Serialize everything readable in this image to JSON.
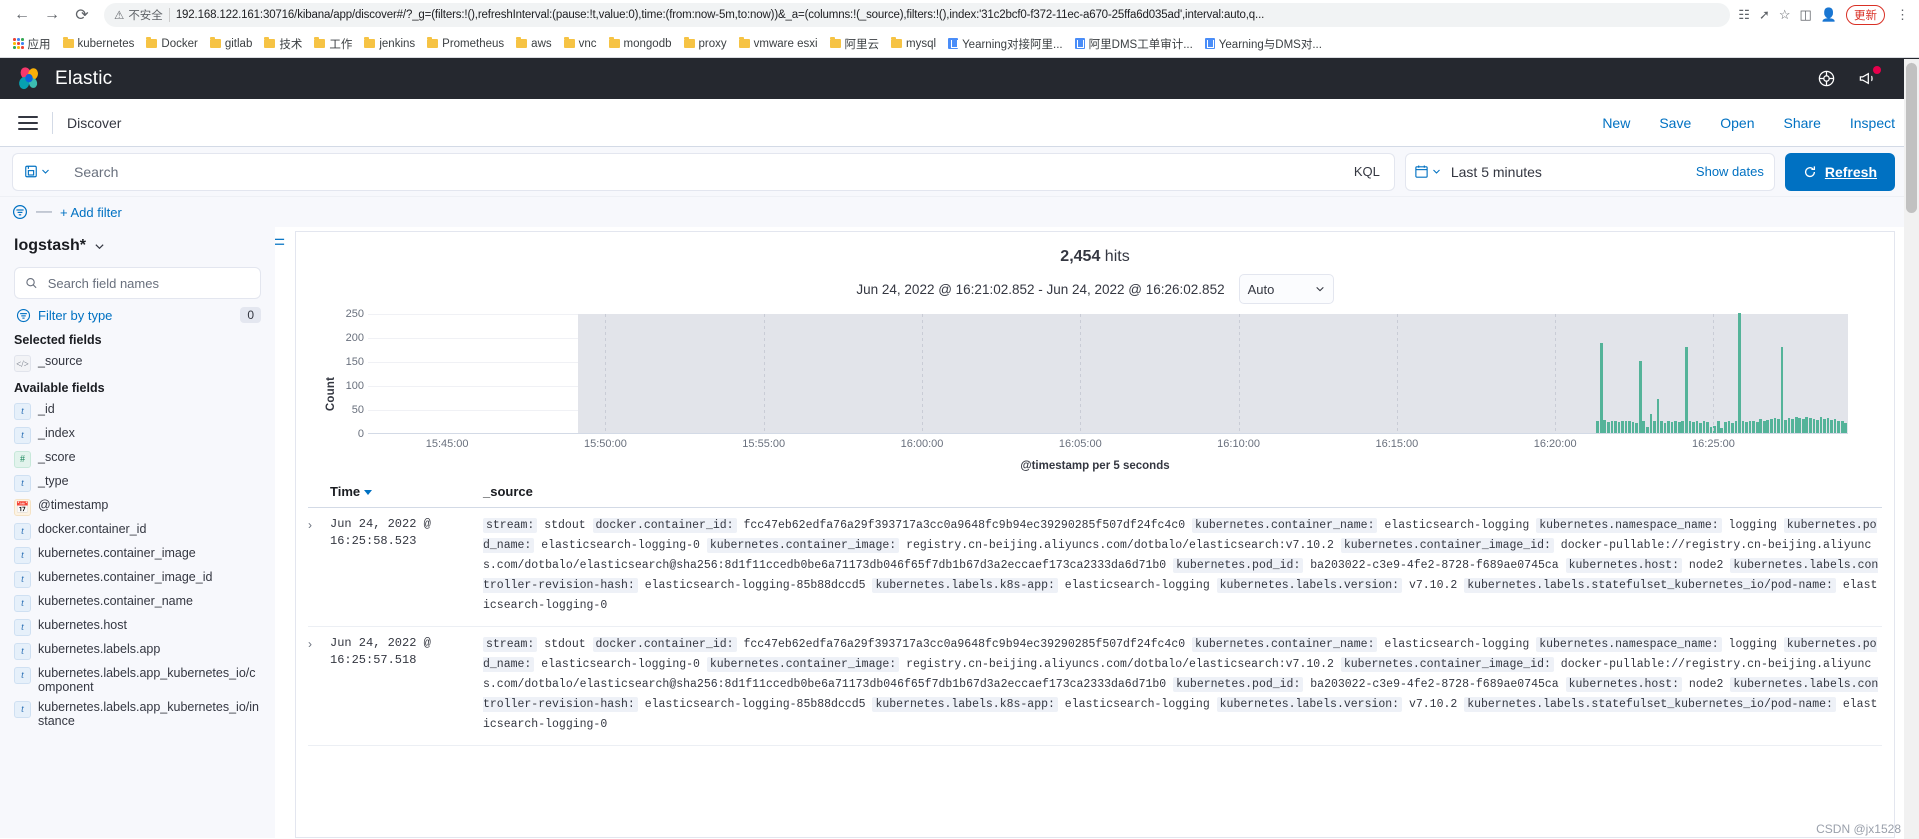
{
  "browser": {
    "back_icon": "back-arrow",
    "forward_icon": "forward-arrow",
    "reload_icon": "reload",
    "security_label": "不安全",
    "url": "192.168.122.161:30716/kibana/app/discover#/?_g=(filters:!(),refreshInterval:(pause:!t,value:0),time:(from:now-5m,to:now))&_a=(columns:!(_source),filters:!(),index:'31c2bcf0-f372-11ec-a670-25ffa6d035ad',interval:auto,q...",
    "update_label": "更新",
    "apps_label": "应用",
    "bookmarks": [
      {
        "label": "kubernetes",
        "type": "folder"
      },
      {
        "label": "Docker",
        "type": "folder"
      },
      {
        "label": "gitlab",
        "type": "folder"
      },
      {
        "label": "技术",
        "type": "folder"
      },
      {
        "label": "工作",
        "type": "folder"
      },
      {
        "label": "jenkins",
        "type": "folder"
      },
      {
        "label": "Prometheus",
        "type": "folder"
      },
      {
        "label": "aws",
        "type": "folder"
      },
      {
        "label": "vnc",
        "type": "folder"
      },
      {
        "label": "mongodb",
        "type": "folder"
      },
      {
        "label": "proxy",
        "type": "folder"
      },
      {
        "label": "vmware esxi",
        "type": "folder"
      },
      {
        "label": "阿里云",
        "type": "folder"
      },
      {
        "label": "mysql",
        "type": "folder"
      },
      {
        "label": "Yearning对接阿里...",
        "type": "bookmark"
      },
      {
        "label": "阿里DMS工单审计...",
        "type": "bookmark"
      },
      {
        "label": "Yearning与DMS对...",
        "type": "bookmark"
      }
    ]
  },
  "header": {
    "brand": "Elastic",
    "help_icon": "help-circle-icon",
    "news_icon": "megaphone-icon"
  },
  "breadcrumb": {
    "title": "Discover",
    "links": [
      "New",
      "Save",
      "Open",
      "Share",
      "Inspect"
    ]
  },
  "query": {
    "save_query_icon": "save-query-icon",
    "placeholder": "Search",
    "language": "KQL",
    "date_range": "Last 5 minutes",
    "show_dates": "Show dates",
    "refresh": "Refresh",
    "calendar_icon": "calendar-icon"
  },
  "filters": {
    "add_filter": "+ Add filter",
    "filter_icon": "filter-icon"
  },
  "sidebar": {
    "index_pattern": "logstash*",
    "search_placeholder": "Search field names",
    "filter_by_type": "Filter by type",
    "filter_count": "0",
    "selected_title": "Selected fields",
    "available_title": "Available fields",
    "selected_fields": [
      {
        "name": "_source",
        "type": "src"
      }
    ],
    "available_fields": [
      {
        "name": "_id",
        "type": "t"
      },
      {
        "name": "_index",
        "type": "t"
      },
      {
        "name": "_score",
        "type": "num"
      },
      {
        "name": "_type",
        "type": "t"
      },
      {
        "name": "@timestamp",
        "type": "date"
      },
      {
        "name": "docker.container_id",
        "type": "t"
      },
      {
        "name": "kubernetes.container_image",
        "type": "t"
      },
      {
        "name": "kubernetes.container_image_id",
        "type": "t"
      },
      {
        "name": "kubernetes.container_name",
        "type": "t"
      },
      {
        "name": "kubernetes.host",
        "type": "t"
      },
      {
        "name": "kubernetes.labels.app",
        "type": "t"
      },
      {
        "name": "kubernetes.labels.app_kubernetes_io/component",
        "type": "t"
      },
      {
        "name": "kubernetes.labels.app_kubernetes_io/instance",
        "type": "t"
      }
    ]
  },
  "main": {
    "hits_count": "2,454",
    "hits_label": "hits",
    "range_text": "Jun 24, 2022 @ 16:21:02.852 - Jun 24, 2022 @ 16:26:02.852",
    "interval": "Auto",
    "collapse_icon": "collapse-sidebar-icon"
  },
  "chart_data": {
    "type": "bar",
    "title": "",
    "xlabel": "@timestamp per 5 seconds",
    "ylabel": "Count",
    "ylim": [
      0,
      250
    ],
    "yticks": [
      0,
      50,
      100,
      150,
      200,
      250
    ],
    "xticks": [
      "15:45:00",
      "15:50:00",
      "15:55:00",
      "16:00:00",
      "16:05:00",
      "16:10:00",
      "16:15:00",
      "16:20:00",
      "16:25:00"
    ],
    "grid": true,
    "legend": "none",
    "bar_color": "#54b399",
    "shaded_region_note": "grey band covers 15:47:00 onward (data-unavailable shading)",
    "x": [
      "16:20:05",
      "16:20:10",
      "16:20:15",
      "16:20:20",
      "16:20:25",
      "16:20:30",
      "16:20:35",
      "16:20:40",
      "16:20:45",
      "16:20:50",
      "16:20:55",
      "16:21:00",
      "16:21:05",
      "16:21:10",
      "16:21:15",
      "16:21:20",
      "16:21:25",
      "16:21:30",
      "16:21:35",
      "16:21:40",
      "16:21:45",
      "16:21:50",
      "16:21:55",
      "16:22:00",
      "16:22:05",
      "16:22:10",
      "16:22:15",
      "16:22:20",
      "16:22:25",
      "16:22:30",
      "16:22:35",
      "16:22:40",
      "16:22:45",
      "16:22:50",
      "16:22:55",
      "16:23:00",
      "16:23:05",
      "16:23:10",
      "16:23:15",
      "16:23:20",
      "16:23:25",
      "16:23:30",
      "16:23:35",
      "16:23:40",
      "16:23:45",
      "16:23:50",
      "16:23:55",
      "16:24:00",
      "16:24:05",
      "16:24:10",
      "16:24:15",
      "16:24:20",
      "16:24:25",
      "16:24:30",
      "16:24:35",
      "16:24:40",
      "16:24:45",
      "16:24:50",
      "16:24:55",
      "16:25:00",
      "16:25:05",
      "16:25:10",
      "16:25:15",
      "16:25:20",
      "16:25:25",
      "16:25:30",
      "16:25:35",
      "16:25:40",
      "16:25:45",
      "16:25:50",
      "16:25:55"
    ],
    "values": [
      25,
      188,
      28,
      22,
      24,
      26,
      22,
      24,
      26,
      24,
      22,
      20,
      150,
      26,
      12,
      40,
      26,
      70,
      24,
      20,
      24,
      22,
      26,
      22,
      24,
      180,
      26,
      22,
      24,
      20,
      26,
      22,
      12,
      14,
      26,
      10,
      22,
      24,
      20,
      26,
      250,
      24,
      22,
      26,
      24,
      22,
      30,
      26,
      28,
      30,
      32,
      30,
      180,
      28,
      32,
      30,
      34,
      32,
      30,
      34,
      32,
      30,
      28,
      34,
      30,
      32,
      28,
      30,
      26,
      24,
      20
    ]
  },
  "doc_table": {
    "col_time": "Time",
    "col_source": "_source",
    "rows": [
      {
        "time": "Jun 24, 2022 @ 16:25:58.523",
        "fields": [
          {
            "key": "stream:",
            "val": "stdout"
          },
          {
            "key": "docker.container_id:",
            "val": "fcc47eb62edfa76a29f393717a3cc0a9648fc9b94ec39290285f507df24fc4c0"
          },
          {
            "key": "kubernetes.container_name:",
            "val": "elasticsearch-logging"
          },
          {
            "key": "kubernetes.namespace_name:",
            "val": "logging"
          },
          {
            "key": "kubernetes.pod_name:",
            "val": "elasticsearch-logging-0"
          },
          {
            "key": "kubernetes.container_image:",
            "val": "registry.cn-beijing.aliyuncs.com/dotbalo/elasticsearch:v7.10.2"
          },
          {
            "key": "kubernetes.container_image_id:",
            "val": "docker-pullable://registry.cn-beijing.aliyuncs.com/dotbalo/elasticsearch@sha256:8d1f11ccedb0be6a71173db046f65f7db1b67d3a2eccaef173ca2333da6d71b0"
          },
          {
            "key": "kubernetes.pod_id:",
            "val": "ba203022-c3e9-4fe2-8728-f689ae0745ca"
          },
          {
            "key": "kubernetes.host:",
            "val": "node2"
          },
          {
            "key": "kubernetes.labels.controller-revision-hash:",
            "val": "elasticsearch-logging-85b88dccd5"
          },
          {
            "key": "kubernetes.labels.k8s-app:",
            "val": "elasticsearch-logging"
          },
          {
            "key": "kubernetes.labels.version:",
            "val": "v7.10.2"
          },
          {
            "key": "kubernetes.labels.statefulset_kubernetes_io/pod-name:",
            "val": "elasticsearch-logging-0"
          }
        ]
      },
      {
        "time": "Jun 24, 2022 @ 16:25:57.518",
        "fields": [
          {
            "key": "stream:",
            "val": "stdout"
          },
          {
            "key": "docker.container_id:",
            "val": "fcc47eb62edfa76a29f393717a3cc0a9648fc9b94ec39290285f507df24fc4c0"
          },
          {
            "key": "kubernetes.container_name:",
            "val": "elasticsearch-logging"
          },
          {
            "key": "kubernetes.namespace_name:",
            "val": "logging"
          },
          {
            "key": "kubernetes.pod_name:",
            "val": "elasticsearch-logging-0"
          },
          {
            "key": "kubernetes.container_image:",
            "val": "registry.cn-beijing.aliyuncs.com/dotbalo/elasticsearch:v7.10.2"
          },
          {
            "key": "kubernetes.container_image_id:",
            "val": "docker-pullable://registry.cn-beijing.aliyuncs.com/dotbalo/elasticsearch@sha256:8d1f11ccedb0be6a71173db046f65f7db1b67d3a2eccaef173ca2333da6d71b0"
          },
          {
            "key": "kubernetes.pod_id:",
            "val": "ba203022-c3e9-4fe2-8728-f689ae0745ca"
          },
          {
            "key": "kubernetes.host:",
            "val": "node2"
          },
          {
            "key": "kubernetes.labels.controller-revision-hash:",
            "val": "elasticsearch-logging-85b88dccd5"
          },
          {
            "key": "kubernetes.labels.k8s-app:",
            "val": "elasticsearch-logging"
          },
          {
            "key": "kubernetes.labels.version:",
            "val": "v7.10.2"
          },
          {
            "key": "kubernetes.labels.statefulset_kubernetes_io/pod-name:",
            "val": "elasticsearch-logging-0"
          }
        ]
      }
    ]
  },
  "watermark": "CSDN @jx1528"
}
